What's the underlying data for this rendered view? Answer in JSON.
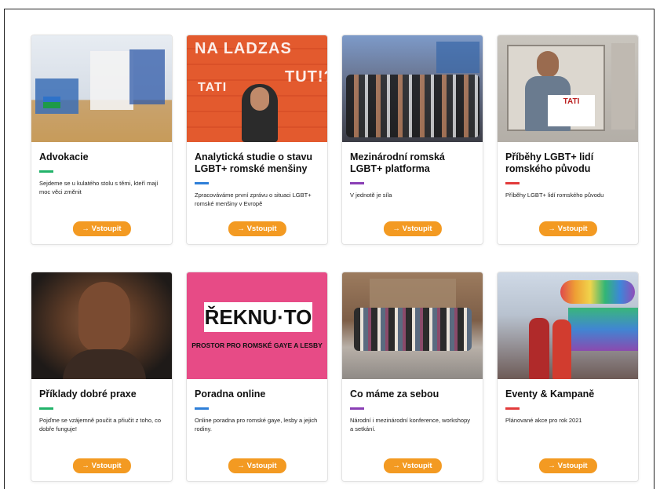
{
  "cards": [
    {
      "title": "Advokacie",
      "description": "Sejdeme se u kulatého stolu s těmi, kteří mají moc věci změnit",
      "accent_color": "#22b36a",
      "button_label": "→ Vstoupit"
    },
    {
      "title": "Analytická studie o stavu LGBT+ romské menšiny",
      "description": "Zpracováváme první zprávu o situaci LGBT+ romské menšiny v Evropě",
      "accent_color": "#2e7fd8",
      "button_label": "→ Vstoupit",
      "image_text": [
        "NA LADZAS",
        "TATI",
        "TUT!?"
      ]
    },
    {
      "title": "Mezinárodní romská LGBT+ platforma",
      "description": "V jednotě je síla",
      "accent_color": "#8a3fb5",
      "button_label": "→ Vstoupit"
    },
    {
      "title": "Příběhy LGBT+ lidí romského původu",
      "description": "Příběhy LGBT+ lidí romského původu",
      "accent_color": "#e23b3b",
      "button_label": "→ Vstoupit",
      "image_text": [
        "TATI"
      ]
    },
    {
      "title": "Příklady dobré praxe",
      "description": "Pojďme se vzájemně poučit a přiučit z toho, co dobře funguje!",
      "accent_color": "#22b36a",
      "button_label": "→ Vstoupit"
    },
    {
      "title": "Poradna online",
      "description": "Online poradna pro romské gaye, lesby a jejich rodiny.",
      "accent_color": "#2e7fd8",
      "button_label": "→ Vstoupit",
      "image_text": [
        "ŘEKNU·TO",
        "PROSTOR PRO ROMSKÉ GAYE A LESBY"
      ]
    },
    {
      "title": "Co máme za sebou",
      "description": "Národní i mezinárodní konference, workshopy a setkání.",
      "accent_color": "#8a3fb5",
      "button_label": "→ Vstoupit"
    },
    {
      "title": "Eventy & Kampaně",
      "description": "Plánované akce pro rok 2021",
      "accent_color": "#e23b3b",
      "button_label": "→ Vstoupit"
    }
  ],
  "colors": {
    "button": "#f39a22",
    "button_text": "#ffffff",
    "page_bg": "#ffffff"
  }
}
